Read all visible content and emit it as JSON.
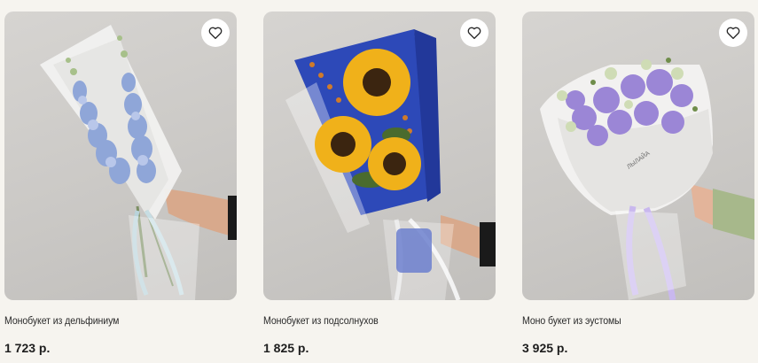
{
  "products": [
    {
      "title": "Монобукет из дельфиниум",
      "price": "1 723 р.",
      "image_icon": "delphinium-bouquet-photo",
      "favorite_icon": "heart-icon"
    },
    {
      "title": "Монобукет из подсолнухов",
      "price": "1 825 р.",
      "image_icon": "sunflower-bouquet-photo",
      "favorite_icon": "heart-icon"
    },
    {
      "title": "Моно букет из эустомы",
      "price": "3 925 р.",
      "image_icon": "eustoma-bouquet-photo",
      "favorite_icon": "heart-icon",
      "wrap_label": "ЛЫЛАЙА"
    }
  ],
  "colors": {
    "background": "#f6f4ef",
    "text": "#2a2a2a",
    "delphinium": "#8fa6d8",
    "sunflower": "#f0b11a",
    "wrap_blue": "#2d49b8",
    "eustoma": "#9b86d6",
    "ribbon_lilac": "#c9b8ee"
  }
}
